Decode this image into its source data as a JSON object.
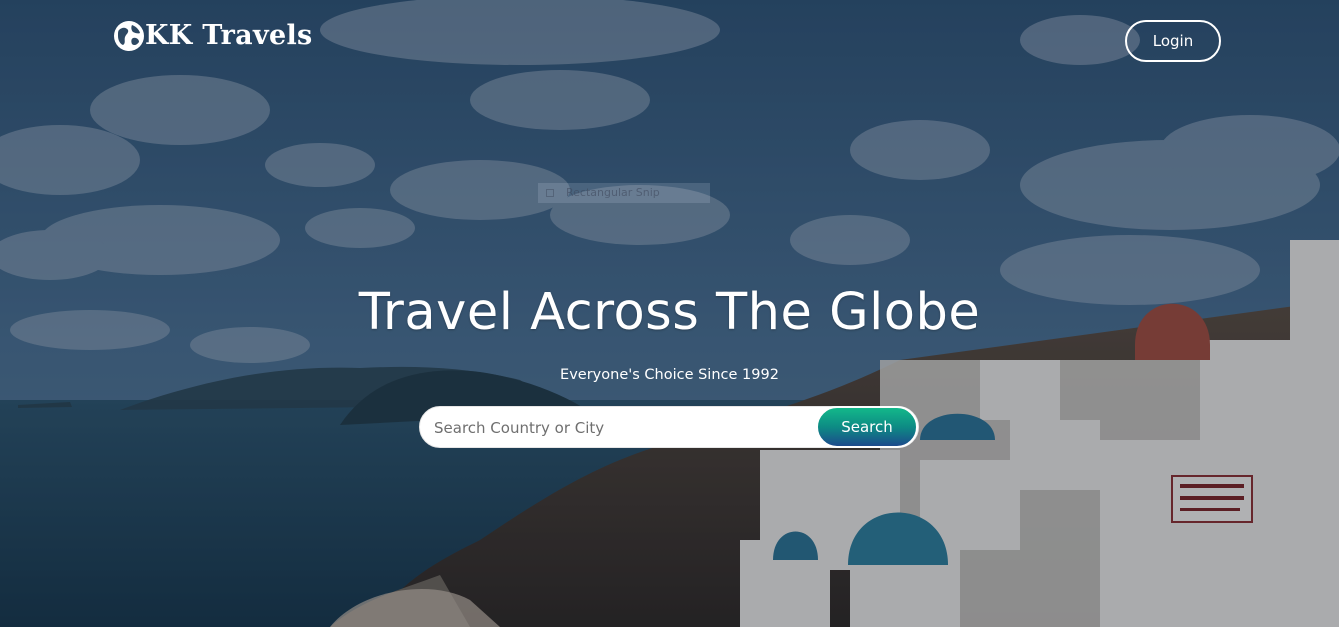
{
  "brand": {
    "name": "KK Travels",
    "icon": "globe-icon"
  },
  "nav": {
    "login_label": "Login"
  },
  "hero": {
    "title": "Travel Across The Globe",
    "subtitle": "Everyone's Choice Since 1992"
  },
  "search": {
    "placeholder": "Search Country or City",
    "value": "",
    "button_label": "Search"
  },
  "overlay_artifact": {
    "label": "Rectangular Snip"
  },
  "colors": {
    "text": "#ffffff",
    "search_button_top": "#13b88a",
    "search_button_bottom": "#1c4a8c",
    "sky": "#3b5f80",
    "sea": "#1f4257"
  }
}
